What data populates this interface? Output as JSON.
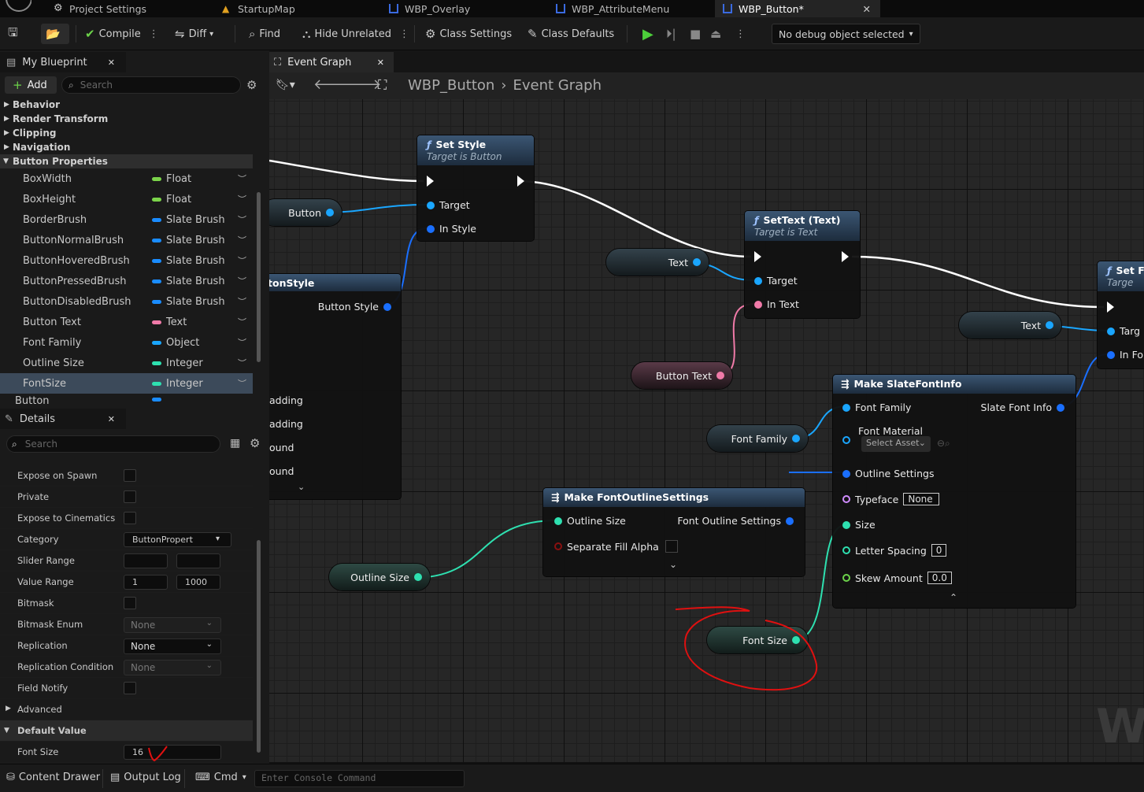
{
  "tabs": [
    {
      "label": "Project Settings",
      "active": false
    },
    {
      "label": "StartupMap",
      "active": false
    },
    {
      "label": "WBP_Overlay",
      "active": false
    },
    {
      "label": "WBP_AttributeMenu",
      "active": false
    },
    {
      "label": "WBP_Button*",
      "active": true
    }
  ],
  "toolbar": {
    "compile": "Compile",
    "diff": "Diff",
    "find": "Find",
    "hide_unrelated": "Hide Unrelated",
    "class_settings": "Class Settings",
    "class_defaults": "Class Defaults",
    "debug_object": "No debug object selected"
  },
  "my_blueprint": {
    "title": "My Blueprint",
    "add": "Add",
    "search_placeholder": "Search",
    "categories": [
      "Behavior",
      "Render Transform",
      "Clipping",
      "Navigation",
      "Button Properties"
    ],
    "variables": [
      {
        "name": "BoxWidth",
        "type": "Float",
        "color": "#7bd34a"
      },
      {
        "name": "BoxHeight",
        "type": "Float",
        "color": "#7bd34a"
      },
      {
        "name": "BorderBrush",
        "type": "Slate Brush",
        "color": "#1a8cff"
      },
      {
        "name": "ButtonNormalBrush",
        "type": "Slate Brush",
        "color": "#1a8cff"
      },
      {
        "name": "ButtonHoveredBrush",
        "type": "Slate Brush",
        "color": "#1a8cff"
      },
      {
        "name": "ButtonPressedBrush",
        "type": "Slate Brush",
        "color": "#1a8cff"
      },
      {
        "name": "ButtonDisabledBrush",
        "type": "Slate Brush",
        "color": "#1a8cff"
      },
      {
        "name": "Button Text",
        "type": "Text",
        "color": "#f07aa8"
      },
      {
        "name": "Font Family",
        "type": "Object",
        "color": "#1aa6ff"
      },
      {
        "name": "Outline Size",
        "type": "Integer",
        "color": "#2ee0b0"
      },
      {
        "name": "FontSize",
        "type": "Integer",
        "color": "#2ee0b0",
        "selected": true
      }
    ],
    "partial_item": "Button"
  },
  "details": {
    "title": "Details",
    "search_placeholder": "Search",
    "rows": {
      "expose_on_spawn": "Expose on Spawn",
      "private": "Private",
      "expose_to_cinematics": "Expose to Cinematics",
      "category": "Category",
      "category_value": "ButtonPropert",
      "slider_range": "Slider Range",
      "value_range": "Value Range",
      "value_range_min": "1",
      "value_range_max": "1000",
      "bitmask": "Bitmask",
      "bitmask_enum": "Bitmask Enum",
      "bitmask_enum_value": "None",
      "replication": "Replication",
      "replication_value": "None",
      "replication_condition": "Replication Condition",
      "replication_condition_value": "None",
      "field_notify": "Field Notify",
      "advanced": "Advanced",
      "default_value": "Default Value",
      "font_size": "Font Size",
      "font_size_value": "16"
    }
  },
  "graph": {
    "tab": "Event Graph",
    "breadcrumb_bp": "WBP_Button",
    "breadcrumb_graph": "Event Graph",
    "set_style": {
      "title": "Set Style",
      "subtitle": "Target is Button",
      "pin_target": "Target",
      "pin_style": "In Style"
    },
    "settext": {
      "title": "SetText (Text)",
      "subtitle": "Target is Text",
      "pin_target": "Target",
      "pin_text": "In Text"
    },
    "set_font": {
      "title": "Set F",
      "subtitle": "Targe",
      "pin_target": "Targ",
      "pin_in": "In Fo"
    },
    "button_style_node": {
      "title": "tonStyle",
      "pin": "Button Style",
      "rows": [
        "adding",
        "adding",
        "ound",
        "ound"
      ]
    },
    "make_slate_font": {
      "title": "Make SlateFontInfo",
      "font_family": "Font Family",
      "output": "Slate Font Info",
      "font_material": "Font Material",
      "select_asset": "Select Asset",
      "outline_settings": "Outline Settings",
      "typeface": "Typeface",
      "typeface_value": "None",
      "size": "Size",
      "letter_spacing": "Letter Spacing",
      "letter_spacing_value": "0",
      "skew_amount": "Skew Amount",
      "skew_amount_value": "0.0"
    },
    "make_outline": {
      "title": "Make FontOutlineSettings",
      "outline_size": "Outline Size",
      "output": "Font Outline Settings",
      "separate_fill_alpha": "Separate Fill Alpha"
    },
    "getters": {
      "button": "Button",
      "text1": "Text",
      "text2": "Text",
      "button_text": "Button Text",
      "font_family": "Font Family",
      "outline_size": "Outline Size",
      "font_size": "Font Size"
    },
    "watermark": "WI"
  },
  "bottom": {
    "content_drawer": "Content Drawer",
    "output_log": "Output Log",
    "cmd": "Cmd",
    "console_placeholder": "Enter Console Command"
  }
}
